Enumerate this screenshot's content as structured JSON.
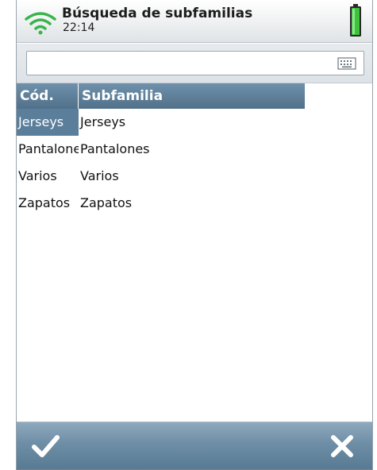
{
  "header": {
    "title": "Búsqueda de subfamilias",
    "time": "22:14",
    "icons": {
      "signal": "wifi-signal-icon",
      "battery": "battery-icon"
    }
  },
  "search": {
    "value": "",
    "placeholder": "",
    "keyboard_icon": "keyboard-icon"
  },
  "table": {
    "columns": [
      "Cód.",
      "Subfamilia"
    ],
    "rows": [
      {
        "code": "Jerseys",
        "name": "Jerseys"
      },
      {
        "code": "Pantalones",
        "name": "Pantalones"
      },
      {
        "code": "Varios",
        "name": "Varios"
      },
      {
        "code": "Zapatos",
        "name": "Zapatos"
      }
    ],
    "selected_index": 0
  },
  "footer": {
    "ok_icon": "checkmark-icon",
    "cancel_icon": "close-icon"
  },
  "colors": {
    "accent": "#5b7f9b",
    "header_cell": "#5f7f98",
    "battery": "#3cc23c",
    "wifi": "#38b44a"
  }
}
